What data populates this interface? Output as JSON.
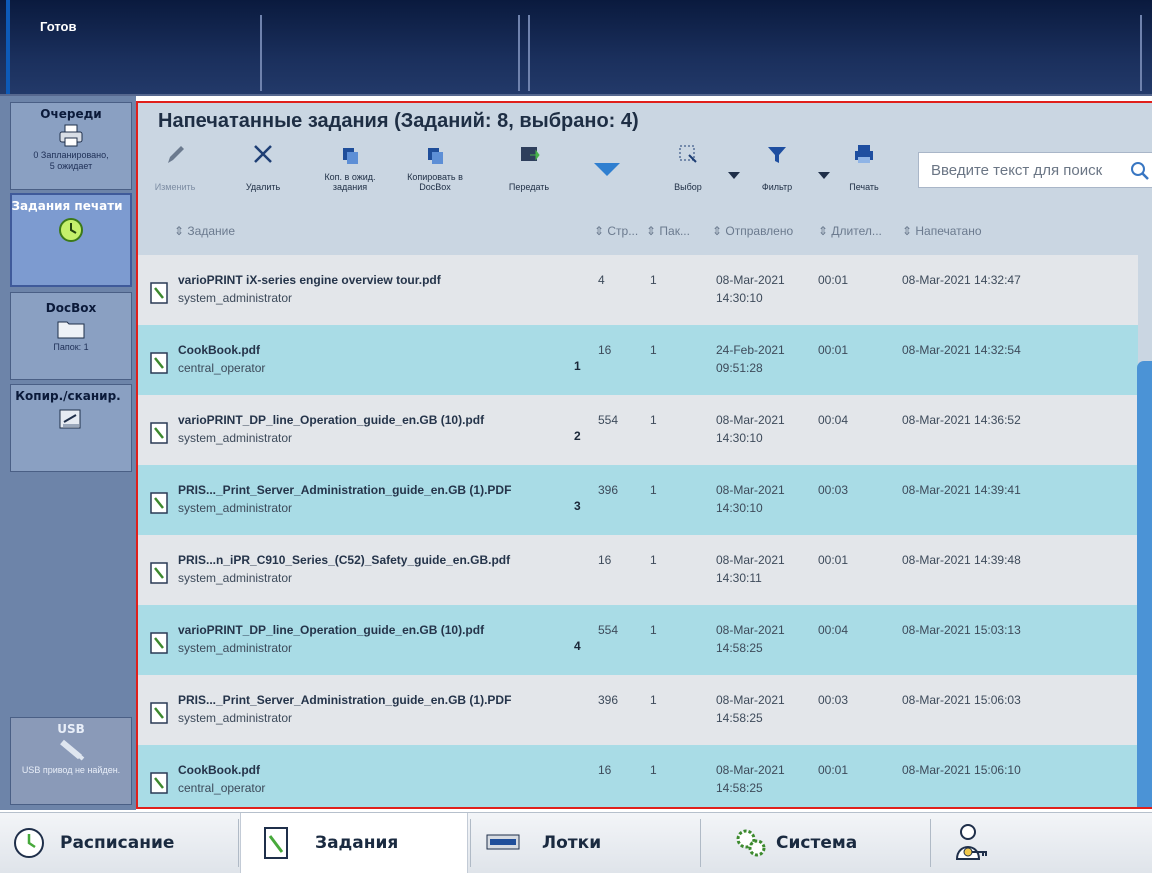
{
  "status": {
    "label": "Готов"
  },
  "sidebar": {
    "queues": {
      "title": "Очереди",
      "sub": "0 Запланировано,\n5 ожидает"
    },
    "printjobs": {
      "title": "Задания печати"
    },
    "docbox": {
      "title": "DocBox",
      "sub": "Папок: 1"
    },
    "copyscan": {
      "title": "Копир./сканир."
    },
    "usb": {
      "title": "USB",
      "sub": "USB привод не найден."
    }
  },
  "main": {
    "title": "Напечатанные задания (Заданий: 8, выбрано: 4)",
    "toolbar": {
      "edit": "Изменить",
      "delete": "Удалить",
      "copy_hold_1": "Коп. в ожид.",
      "copy_hold_2": "задания",
      "copy_docbox_1": "Копировать в",
      "copy_docbox_2": "DocBox",
      "transfer": "Передать",
      "select": "Выбор",
      "filter": "Фильтр",
      "print": "Печать"
    },
    "search": {
      "placeholder": "Введите текст для поиск"
    },
    "columns": {
      "job": "Задание",
      "pages": "Стр...",
      "packs": "Пак...",
      "sent": "Отправлено",
      "duration": "Длител...",
      "printed": "Напечатано"
    },
    "rows": [
      {
        "name": "varioPRINT iX-series engine overview tour.pdf",
        "user": "system_administrator",
        "selno": "",
        "pages": "4",
        "packs": "1",
        "sent_date": "08-Mar-2021",
        "sent_time": "14:30:10",
        "duration": "00:01",
        "printed": "08-Mar-2021 14:32:47"
      },
      {
        "name": "CookBook.pdf",
        "user": "central_operator",
        "selno": "1",
        "pages": "16",
        "packs": "1",
        "sent_date": "24-Feb-2021",
        "sent_time": "09:51:28",
        "duration": "00:01",
        "printed": "08-Mar-2021 14:32:54"
      },
      {
        "name": "varioPRINT_DP_line_Operation_guide_en.GB (10).pdf",
        "user": "system_administrator",
        "selno": "2",
        "pages": "554",
        "packs": "1",
        "sent_date": "08-Mar-2021",
        "sent_time": "14:30:10",
        "duration": "00:04",
        "printed": "08-Mar-2021 14:36:52"
      },
      {
        "name": "PRIS..._Print_Server_Administration_guide_en.GB (1).PDF",
        "user": "system_administrator",
        "selno": "3",
        "pages": "396",
        "packs": "1",
        "sent_date": "08-Mar-2021",
        "sent_time": "14:30:10",
        "duration": "00:03",
        "printed": "08-Mar-2021 14:39:41"
      },
      {
        "name": "PRIS...n_iPR_C910_Series_(C52)_Safety_guide_en.GB.pdf",
        "user": "system_administrator",
        "selno": "",
        "pages": "16",
        "packs": "1",
        "sent_date": "08-Mar-2021",
        "sent_time": "14:30:11",
        "duration": "00:01",
        "printed": "08-Mar-2021 14:39:48"
      },
      {
        "name": "varioPRINT_DP_line_Operation_guide_en.GB (10).pdf",
        "user": "system_administrator",
        "selno": "4",
        "pages": "554",
        "packs": "1",
        "sent_date": "08-Mar-2021",
        "sent_time": "14:58:25",
        "duration": "00:04",
        "printed": "08-Mar-2021 15:03:13"
      },
      {
        "name": "PRIS..._Print_Server_Administration_guide_en.GB (1).PDF",
        "user": "system_administrator",
        "selno": "",
        "pages": "396",
        "packs": "1",
        "sent_date": "08-Mar-2021",
        "sent_time": "14:58:25",
        "duration": "00:03",
        "printed": "08-Mar-2021 15:06:03"
      },
      {
        "name": "CookBook.pdf",
        "user": "central_operator",
        "selno": "",
        "pages": "16",
        "packs": "1",
        "sent_date": "08-Mar-2021",
        "sent_time": "14:58:25",
        "duration": "00:01",
        "printed": "08-Mar-2021 15:06:10"
      }
    ]
  },
  "bottomnav": {
    "schedule": "Расписание",
    "jobs": "Задания",
    "trays": "Лотки",
    "system": "Система"
  },
  "colors": {
    "selected_row": "#a9dce6",
    "unselected_row": "#e3e6ea",
    "accent": "#e0201c",
    "scrollbar": "#4b93d6"
  },
  "icons": [
    "printer-icon",
    "clock-icon",
    "folder-icon",
    "scanner-icon",
    "usb-icon",
    "pencil-icon",
    "close-icon",
    "copy-icon",
    "send-icon",
    "dropdown-icon",
    "select-icon",
    "filter-icon",
    "print-icon",
    "search-icon",
    "document-icon",
    "schedule-icon",
    "jobs-icon",
    "trays-icon",
    "system-icon",
    "user-key-icon"
  ]
}
